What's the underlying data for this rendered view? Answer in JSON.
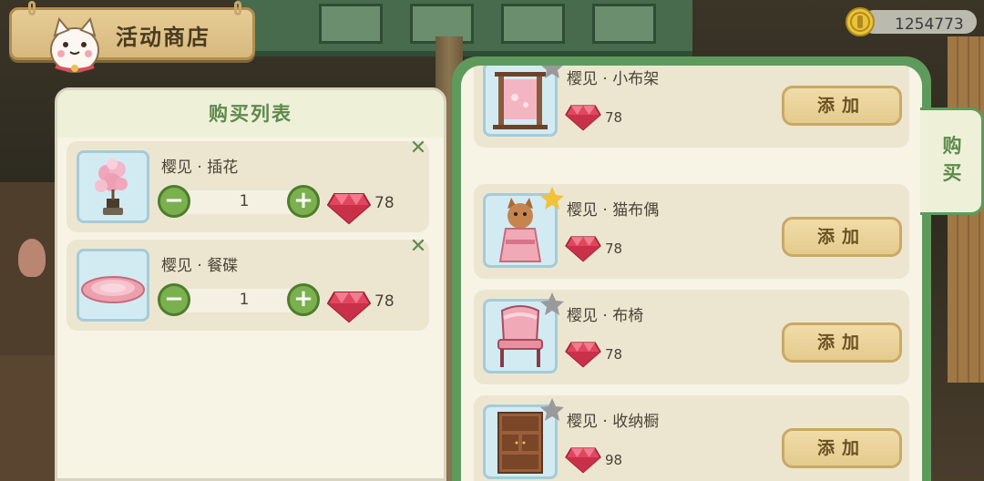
{
  "header": {
    "title": "活动商店"
  },
  "currency": {
    "amount": "1254773",
    "icon": "gold-coin-icon"
  },
  "cart": {
    "title": "购买列表",
    "items": [
      {
        "name": "樱见 · 插花",
        "quantity": "1",
        "price": "78",
        "icon": "flower-arrangement-icon"
      },
      {
        "name": "樱见 · 餐碟",
        "quantity": "1",
        "price": "78",
        "icon": "plate-icon"
      }
    ]
  },
  "shop": {
    "items": [
      {
        "name": "樱见 · 小布架",
        "price": "78",
        "button": "添加",
        "icon": "cloth-rack-icon"
      },
      {
        "name": "樱见 · 猫布偶",
        "price": "78",
        "button": "添加",
        "icon": "cat-doll-icon"
      },
      {
        "name": "樱见 · 布椅",
        "price": "78",
        "button": "添加",
        "icon": "cloth-chair-icon"
      },
      {
        "name": "樱见 · 收纳橱",
        "price": "98",
        "button": "添加",
        "icon": "storage-cabinet-icon"
      }
    ]
  },
  "tab": {
    "label": "购买"
  },
  "colors": {
    "accent_green": "#5d8a4c",
    "panel": "#f7f3e5",
    "gem": "#e0475f",
    "button": "#e4cb8e"
  }
}
